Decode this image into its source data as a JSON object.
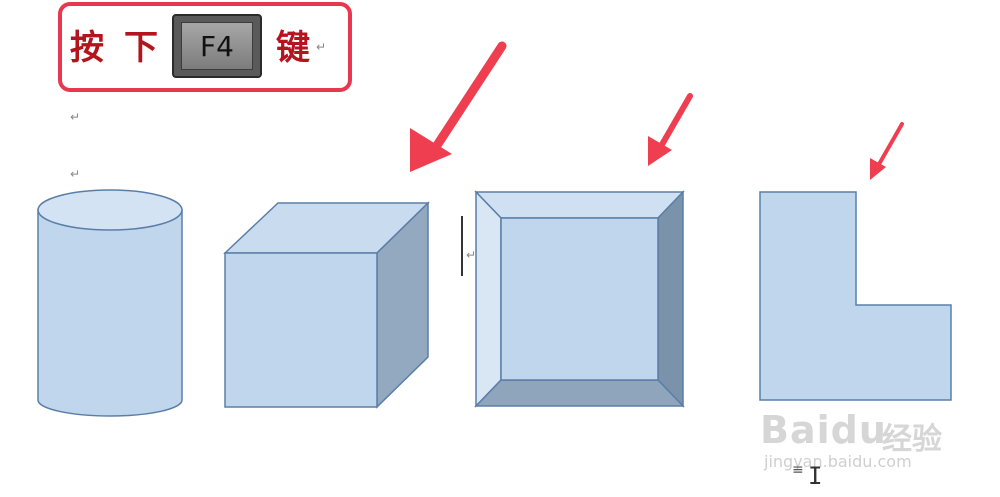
{
  "instruction": {
    "press": "按",
    "down": "下",
    "key": "F4",
    "key_suffix": "键",
    "return_mark": "↵"
  },
  "paragraph_marks": [
    "↵",
    "↵",
    "↵"
  ],
  "watermark": {
    "logo": "Baidu",
    "cn": "经验",
    "url": "jingyan.baidu.com"
  },
  "colors": {
    "callout_border": "#e8384f",
    "instruction_text": "#b3141e",
    "arrow": "#ef3e50",
    "shape_fill": "#bfd6ec",
    "shape_stroke": "#5b7ea7",
    "shape_dark": "#8ea5bb"
  },
  "shapes": [
    "cylinder",
    "cube",
    "bevel",
    "l-shape"
  ],
  "cursor": "I"
}
